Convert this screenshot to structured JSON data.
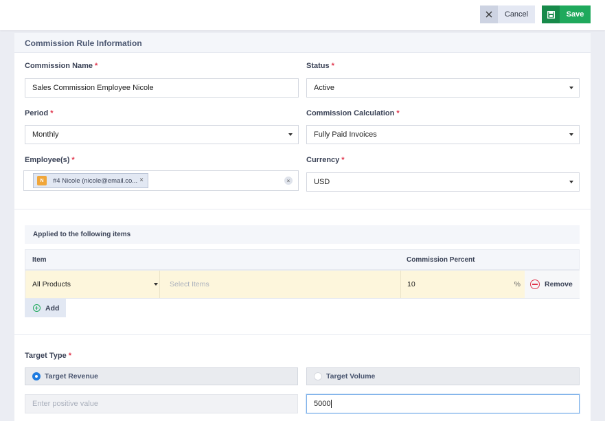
{
  "toolbar": {
    "cancel_label": "Cancel",
    "save_label": "Save"
  },
  "section": {
    "title": "Commission Rule Information"
  },
  "form": {
    "commission_name": {
      "label": "Commission Name",
      "value": "Sales Commission Employee Nicole"
    },
    "status": {
      "label": "Status",
      "value": "Active"
    },
    "period": {
      "label": "Period",
      "value": "Monthly"
    },
    "calculation": {
      "label": "Commission Calculation",
      "value": "Fully Paid Invoices"
    },
    "employees": {
      "label": "Employee(s)",
      "tag_avatar": "N",
      "tag_text": "#4 Nicole (nicole@email.co..."
    },
    "currency": {
      "label": "Currency",
      "value": "USD"
    },
    "required_mark": "*"
  },
  "items": {
    "title": "Applied to the following items",
    "columns": {
      "item": "Item",
      "percent": "Commission Percent"
    },
    "row": {
      "item": "All Products",
      "select_placeholder": "Select Items",
      "percent": "10",
      "percent_sign": "%",
      "remove_label": "Remove"
    },
    "add_label": "Add"
  },
  "target": {
    "label": "Target Type",
    "options": [
      "Target Revenue",
      "Target Volume"
    ],
    "selected": "Target Revenue",
    "revenue_placeholder": "Enter positive value",
    "volume_value": "5000"
  },
  "colors": {
    "accent_green": "#1fa95c",
    "accent_blue": "#1e7be0",
    "required_red": "#e0344b",
    "highlight_row": "#fdf6dc"
  },
  "icons": {
    "cancel": "close-icon",
    "save": "save-icon",
    "remove": "minus-circle-icon",
    "add": "plus-circle-icon"
  }
}
